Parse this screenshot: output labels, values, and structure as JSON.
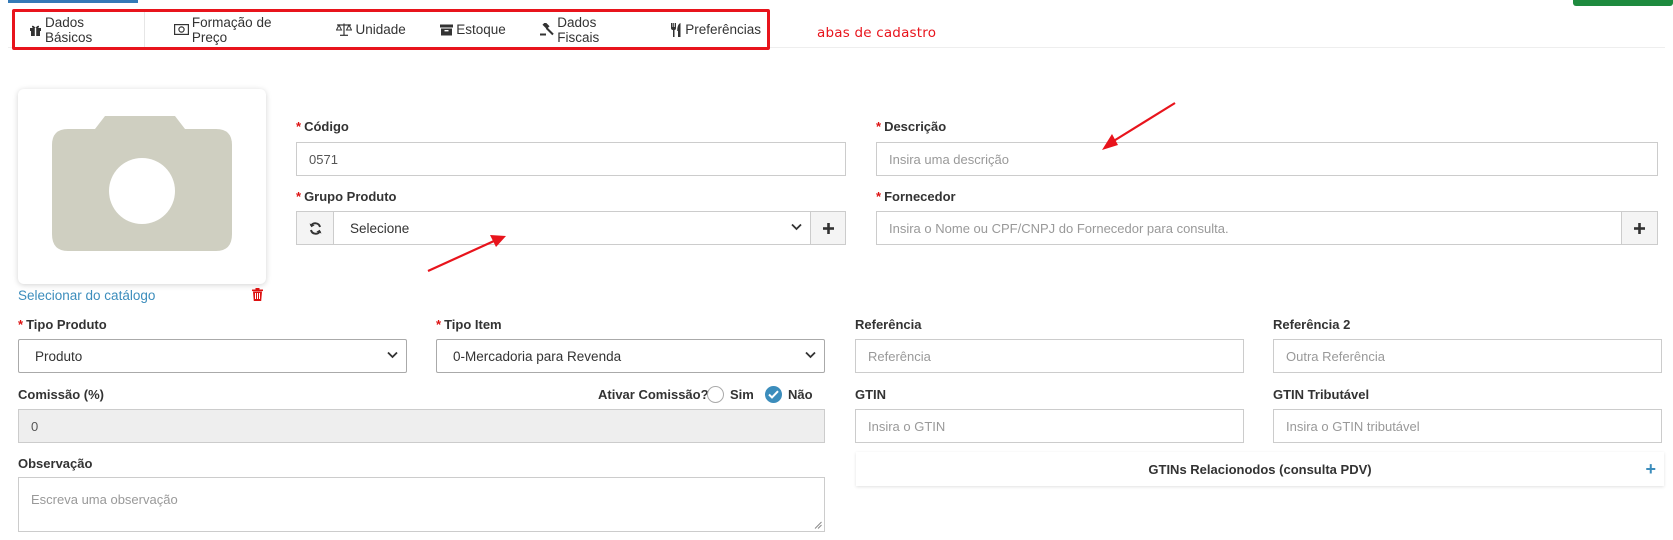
{
  "tabs": [
    {
      "label": "Dados Básicos",
      "icon": "gift-icon"
    },
    {
      "label": "Formação de Preço",
      "icon": "money-icon"
    },
    {
      "label": "Unidade",
      "icon": "balance-scale-icon"
    },
    {
      "label": "Estoque",
      "icon": "archive-box-icon"
    },
    {
      "label": "Dados Fiscais",
      "icon": "gavel-icon"
    },
    {
      "label": "Preferências",
      "icon": "cutlery-icon"
    }
  ],
  "annotation_text": "abas de cadastro",
  "photo": {
    "catalog_link": "Selecionar do catálogo"
  },
  "fields": {
    "codigo": {
      "label": "Código",
      "value": "0571"
    },
    "descricao": {
      "label": "Descrição",
      "placeholder": "Insira uma descrição"
    },
    "grupo_produto": {
      "label": "Grupo Produto",
      "value": "Selecione"
    },
    "fornecedor": {
      "label": "Fornecedor",
      "placeholder": "Insira o Nome ou CPF/CNPJ do Fornecedor para consulta."
    },
    "tipo_produto": {
      "label": "Tipo Produto",
      "value": "Produto"
    },
    "tipo_item": {
      "label": "Tipo Item",
      "value": "0-Mercadoria para Revenda"
    },
    "referencia": {
      "label": "Referência",
      "placeholder": "Referência"
    },
    "referencia2": {
      "label": "Referência 2",
      "placeholder": "Outra Referência"
    },
    "comissao": {
      "label": "Comissão (%)",
      "value": "0"
    },
    "ativar_comissao": {
      "label": "Ativar Comissão?",
      "options": [
        "Sim",
        "Não"
      ],
      "selected": "Não"
    },
    "gtin": {
      "label": "GTIN",
      "placeholder": "Insira o GTIN"
    },
    "gtin_tributavel": {
      "label": "GTIN Tributável",
      "placeholder": "Insira o GTIN tributável"
    },
    "observacao": {
      "label": "Observação",
      "placeholder": "Escreva uma observação"
    }
  },
  "gtins_panel": {
    "title": "GTINs Relacionodos (consulta PDV)",
    "add": "+"
  },
  "required_mark": "*",
  "colors": {
    "annotation": "#e8141c",
    "link": "#3c8dbc",
    "required": "#dd1111",
    "camera": "#cfcfc1"
  }
}
